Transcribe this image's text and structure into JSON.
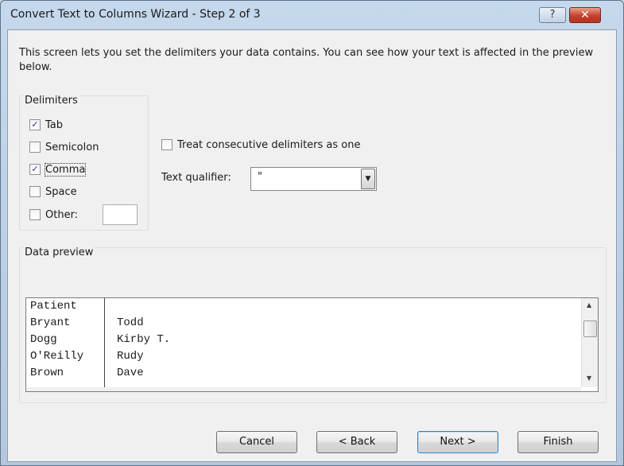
{
  "window": {
    "title": "Convert Text to Columns Wizard - Step 2 of 3",
    "help_label": "?",
    "close_label": "✕"
  },
  "intro_text": "This screen lets you set the delimiters your data contains.  You can see how your text is affected in the preview below.",
  "delimiters": {
    "group_label": "Delimiters",
    "items": [
      {
        "label": "Tab",
        "checked": true,
        "mark": "✓"
      },
      {
        "label": "Semicolon",
        "checked": false,
        "mark": ""
      },
      {
        "label": "Comma",
        "checked": true,
        "mark": "✓"
      },
      {
        "label": "Space",
        "checked": false,
        "mark": ""
      },
      {
        "label": "Other:",
        "checked": false,
        "mark": ""
      }
    ],
    "other_value": ""
  },
  "consecutive": {
    "label": "Treat consecutive delimiters as one",
    "checked": false
  },
  "qualifier": {
    "label": "Text qualifier:",
    "value": "\""
  },
  "preview": {
    "label": "Data preview",
    "columns": [
      [
        "Patient",
        "Bryant",
        "Dogg",
        "O'Reilly",
        "Brown"
      ],
      [
        "",
        "Todd",
        "Kirby T.",
        "Rudy",
        "Dave"
      ]
    ]
  },
  "buttons": {
    "cancel": "Cancel",
    "back": "< Back",
    "next": "Next >",
    "finish": "Finish"
  },
  "colors": {
    "accent": "#3c7fb1",
    "close": "#c4402b",
    "check": "#23408a"
  },
  "icons": {
    "help": "question-mark-icon",
    "close": "close-x-icon",
    "dropdown": "chevron-down-icon",
    "scroll_up": "scroll-up-arrow-icon",
    "scroll_down": "scroll-down-arrow-icon",
    "scroll_left": "scroll-left-arrow-icon",
    "scroll_right": "scroll-right-arrow-icon"
  }
}
